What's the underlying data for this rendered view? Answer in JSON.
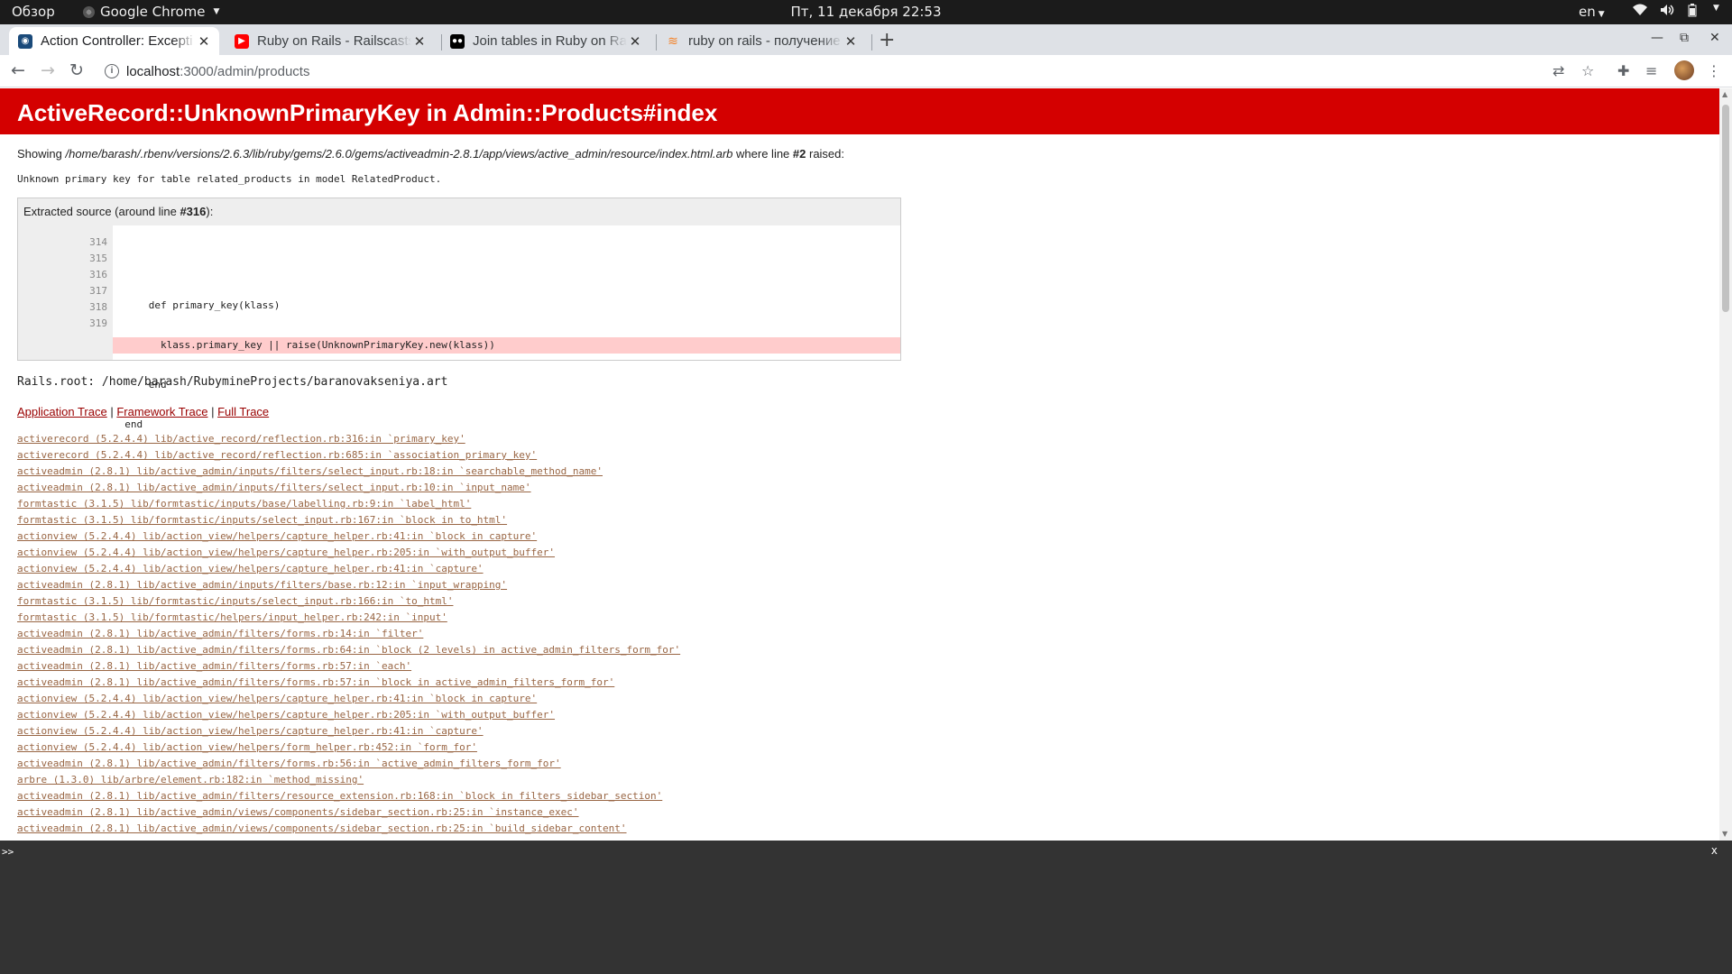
{
  "system": {
    "overview": "Обзор",
    "app": "Google Chrome",
    "clock": "Пт, 11 декабря  22:53",
    "lang": "en"
  },
  "tabs": [
    {
      "title": "Action Controller: Excepti",
      "active": true,
      "favicon_color": "#1a4a7a"
    },
    {
      "title": "Ruby on Rails - Railscasts",
      "active": false,
      "favicon_color": "#ff0000"
    },
    {
      "title": "Join tables in Ruby on Rai",
      "active": false,
      "favicon_color": "#000000"
    },
    {
      "title": "ruby on rails - получение",
      "active": false,
      "favicon_color": "#f48024"
    }
  ],
  "address": {
    "host": "localhost",
    "path": ":3000/admin/products"
  },
  "error": {
    "title": "ActiveRecord::UnknownPrimaryKey in Admin::Products#index",
    "showing_prefix": "Showing ",
    "showing_file": "/home/barash/.rbenv/versions/2.6.3/lib/ruby/gems/2.6.0/gems/activeadmin-2.8.1/app/views/active_admin/resource/index.html.arb",
    "showing_mid": " where line ",
    "showing_line": "#2",
    "showing_suffix": " raised:",
    "message": "Unknown primary key for table related_products in model RelatedProduct.",
    "extracted_prefix": "Extracted source (around line ",
    "extracted_line": "#316",
    "extracted_suffix": "):",
    "line_numbers": [
      "314",
      "315",
      "316",
      "317",
      "318",
      "319"
    ],
    "code_lines": [
      "",
      "      def primary_key(klass)",
      "        klass.primary_key || raise(UnknownPrimaryKey.new(klass))",
      "      end",
      "  end",
      ""
    ],
    "rails_root": "Rails.root: /home/barash/RubymineProjects/baranovakseniya.art",
    "trace_links": [
      "Application Trace",
      "Framework Trace",
      "Full Trace"
    ],
    "trace_sep": " | ",
    "traces": [
      "activerecord (5.2.4.4) lib/active_record/reflection.rb:316:in `primary_key'",
      "activerecord (5.2.4.4) lib/active_record/reflection.rb:685:in `association_primary_key'",
      "activeadmin (2.8.1) lib/active_admin/inputs/filters/select_input.rb:18:in `searchable_method_name'",
      "activeadmin (2.8.1) lib/active_admin/inputs/filters/select_input.rb:10:in `input_name'",
      "formtastic (3.1.5) lib/formtastic/inputs/base/labelling.rb:9:in `label_html'",
      "formtastic (3.1.5) lib/formtastic/inputs/select_input.rb:167:in `block in to_html'",
      "actionview (5.2.4.4) lib/action_view/helpers/capture_helper.rb:41:in `block in capture'",
      "actionview (5.2.4.4) lib/action_view/helpers/capture_helper.rb:205:in `with_output_buffer'",
      "actionview (5.2.4.4) lib/action_view/helpers/capture_helper.rb:41:in `capture'",
      "activeadmin (2.8.1) lib/active_admin/inputs/filters/base.rb:12:in `input_wrapping'",
      "formtastic (3.1.5) lib/formtastic/inputs/select_input.rb:166:in `to_html'",
      "formtastic (3.1.5) lib/formtastic/helpers/input_helper.rb:242:in `input'",
      "activeadmin (2.8.1) lib/active_admin/filters/forms.rb:14:in `filter'",
      "activeadmin (2.8.1) lib/active_admin/filters/forms.rb:64:in `block (2 levels) in active_admin_filters_form_for'",
      "activeadmin (2.8.1) lib/active_admin/filters/forms.rb:57:in `each'",
      "activeadmin (2.8.1) lib/active_admin/filters/forms.rb:57:in `block in active_admin_filters_form_for'",
      "actionview (5.2.4.4) lib/action_view/helpers/capture_helper.rb:41:in `block in capture'",
      "actionview (5.2.4.4) lib/action_view/helpers/capture_helper.rb:205:in `with_output_buffer'",
      "actionview (5.2.4.4) lib/action_view/helpers/capture_helper.rb:41:in `capture'",
      "actionview (5.2.4.4) lib/action_view/helpers/form_helper.rb:452:in `form_for'",
      "activeadmin (2.8.1) lib/active_admin/filters/forms.rb:56:in `active_admin_filters_form_for'",
      "arbre (1.3.0) lib/arbre/element.rb:182:in `method_missing'",
      "activeadmin (2.8.1) lib/active_admin/filters/resource_extension.rb:168:in `block in filters_sidebar_section'",
      "activeadmin (2.8.1) lib/active_admin/views/components/sidebar_section.rb:25:in `instance_exec'",
      "activeadmin (2.8.1) lib/active_admin/views/components/sidebar_section.rb:25:in `build_sidebar_content'"
    ]
  },
  "console": {
    "prompt": ">>",
    "close": "x"
  },
  "colors": {
    "error_red": "#d40000",
    "highlight": "#ffcccc",
    "link": "#990000"
  }
}
